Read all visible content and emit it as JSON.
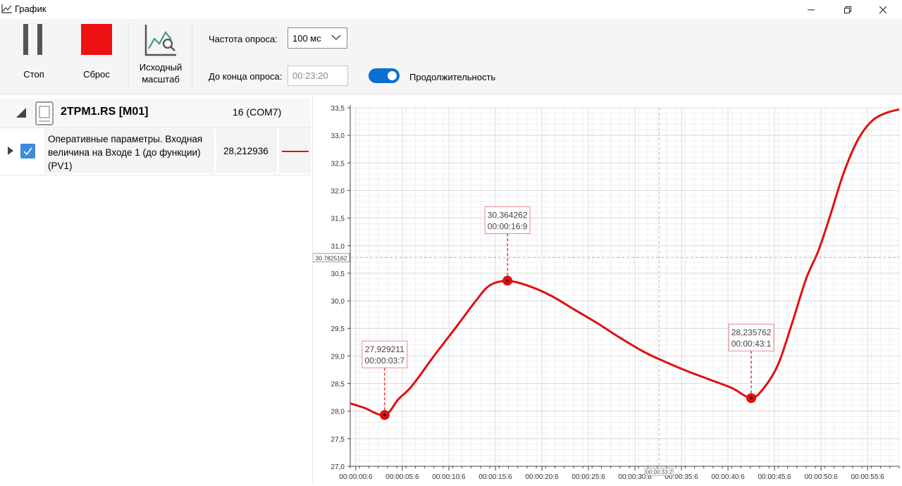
{
  "window": {
    "title": "График",
    "icon": "chart-line-icon",
    "controls": [
      "minimize-icon",
      "restore-icon",
      "close-icon"
    ]
  },
  "toolbar": {
    "stop_label": "Стоп",
    "reset_label": "Сброс",
    "rescale_label_line1": "Исходный",
    "rescale_label_line2": "масштаб",
    "poll_rate_label": "Частота опроса:",
    "poll_rate_value": "100 мс",
    "poll_end_label": "До конца опроса:",
    "poll_end_value": "00:23:20",
    "duration_label": "Продолжительность",
    "duration_enabled": true,
    "accent_color": "#0b6fd1",
    "reset_color": "#ee1111"
  },
  "devices": [
    {
      "name": "2TPM1.RS [M01]",
      "port": "16 (COM7)",
      "params": [
        {
          "name_lines": [
            "Оперативные параметры. Входная",
            "величина на Входе 1 (до функции)",
            "(PV1)"
          ],
          "value": "28,212936",
          "checked": true,
          "color": "#e01010"
        }
      ]
    }
  ],
  "chart_data": {
    "type": "line",
    "y_ticks": [
      "33,5",
      "33,0",
      "32,5",
      "32,0",
      "31,5",
      "31,0",
      "30,5",
      "30,0",
      "29,5",
      "29,0",
      "28,5",
      "28,0",
      "27,5",
      "27,0"
    ],
    "ylim": [
      27.0,
      33.5
    ],
    "x_ticks": [
      "00:00:00:6",
      "00:00:05:6",
      "00:00:10:6",
      "00:00:15:6",
      "00:00:20:6",
      "00:00:25:6",
      "00:00:30:6",
      "00:00:35:6",
      "00:00:40:6",
      "00:00:45:6",
      "00:00:50:6",
      "00:00:55:6"
    ],
    "xlim_seconds": [
      0.0,
      59.0
    ],
    "crosshair": {
      "y_label": "30.7825162",
      "x_label": "00:00:33:2",
      "y": 30.7825162,
      "x": 33.2
    },
    "series": [
      {
        "color": "#e01010",
        "points": [
          [
            0.0,
            28.14
          ],
          [
            1.5,
            28.06
          ],
          [
            3.7,
            27.93
          ],
          [
            5.2,
            28.22
          ],
          [
            6.6,
            28.45
          ],
          [
            9.0,
            29.0
          ],
          [
            11.5,
            29.55
          ],
          [
            13.5,
            30.0
          ],
          [
            15.0,
            30.28
          ],
          [
            16.9,
            30.36
          ],
          [
            19.0,
            30.28
          ],
          [
            21.5,
            30.1
          ],
          [
            24.0,
            29.85
          ],
          [
            26.5,
            29.6
          ],
          [
            29.0,
            29.33
          ],
          [
            31.5,
            29.08
          ],
          [
            33.5,
            28.92
          ],
          [
            36.0,
            28.74
          ],
          [
            38.5,
            28.58
          ],
          [
            41.0,
            28.42
          ],
          [
            43.1,
            28.24
          ],
          [
            44.5,
            28.43
          ],
          [
            46.0,
            28.85
          ],
          [
            47.5,
            29.6
          ],
          [
            49.0,
            30.4
          ],
          [
            50.3,
            30.9
          ],
          [
            51.5,
            31.5
          ],
          [
            53.0,
            32.3
          ],
          [
            54.5,
            32.9
          ],
          [
            56.0,
            33.25
          ],
          [
            57.5,
            33.4
          ],
          [
            59.0,
            33.47
          ]
        ]
      }
    ],
    "markers": [
      {
        "x": 3.7,
        "y": 27.929211,
        "value_label": "27,929211",
        "time_label": "00:00:03:7"
      },
      {
        "x": 16.9,
        "y": 30.364262,
        "value_label": "30,364262",
        "time_label": "00:00:16:9"
      },
      {
        "x": 43.1,
        "y": 28.235762,
        "value_label": "28,235762",
        "time_label": "00:00:43:1"
      }
    ]
  }
}
